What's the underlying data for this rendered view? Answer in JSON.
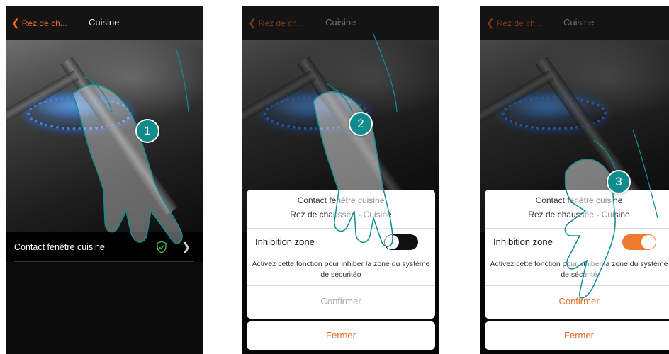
{
  "colors": {
    "accent": "#e86a24",
    "step": "#0f8c8e",
    "shield": "#3bb54a",
    "toggle_off": "#111111",
    "toggle_on": "#ef7a2e"
  },
  "screens": [
    {
      "step": "1",
      "header": {
        "back_label": "Rez de ch...",
        "title": "Cuisine"
      },
      "device_row": {
        "label": "Contact fenêtre cuisine",
        "icons": [
          "shield-icon",
          "chevron-right-icon"
        ]
      }
    },
    {
      "step": "2",
      "header": {
        "back_label": "Rez de ch...",
        "title": "Cuisine"
      },
      "dialog": {
        "title_line1": "Contact fenêtre cuisine",
        "title_line2": "Rez de chaussée - Cuisine",
        "toggle_label": "Inhibition zone",
        "toggle_state": "off",
        "description": "Activez cette fonction pour inhiber la zone du système de sécuritéo",
        "confirm_label": "Confirmer"
      },
      "close_label": "Fermer"
    },
    {
      "step": "3",
      "header": {
        "back_label": "Rez de ch...",
        "title": "Cuisine"
      },
      "dialog": {
        "title_line1": "Contact fenêtre cuisine",
        "title_line2": "Rez de chaussée - Cuisine",
        "toggle_label": "Inhibition zone",
        "toggle_state": "on",
        "description": "Activez cette fonction pour inhiber la zone du système de sécurité",
        "confirm_label": "Confirmer"
      },
      "close_label": "Fermer"
    }
  ]
}
